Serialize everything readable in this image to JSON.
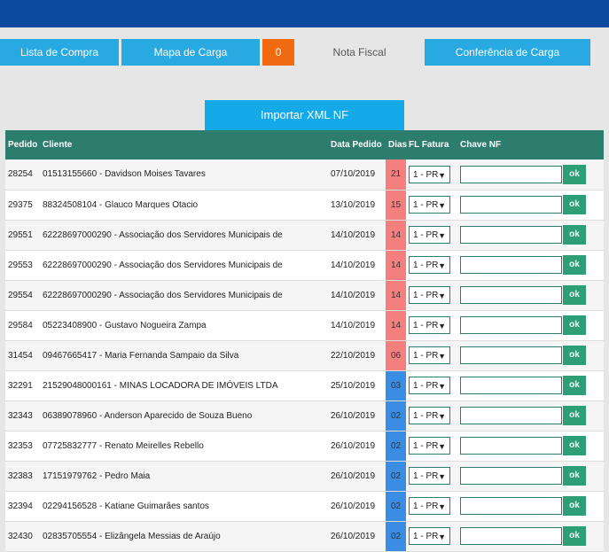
{
  "tabs": [
    {
      "label": "Lista de Compra"
    },
    {
      "label": "Mapa de Carga"
    },
    {
      "label": "0"
    },
    {
      "label": "Nota Fiscal"
    },
    {
      "label": "Conferência de Carga"
    }
  ],
  "import_button": "Importar XML NF",
  "columns": [
    "Pedido",
    "Cliente",
    "Data Pedido",
    "Dias",
    "FL Fatura",
    "Chave NF"
  ],
  "ok_label": "ok",
  "rows": [
    {
      "pedido": "28254",
      "cliente": "01513155660 - Davidson Moises Tavares",
      "data": "07/10/2019",
      "dias": "21",
      "status": "red",
      "fatura": "1 - PR"
    },
    {
      "pedido": "29375",
      "cliente": "88324508104 - Glauco Marques Otacio",
      "data": "13/10/2019",
      "dias": "15",
      "status": "red",
      "fatura": "1 - PR"
    },
    {
      "pedido": "29551",
      "cliente": "62228697000290 - Associação dos Servidores Municipais de",
      "data": "14/10/2019",
      "dias": "14",
      "status": "red",
      "fatura": "1 - PR"
    },
    {
      "pedido": "29553",
      "cliente": "62228697000290 - Associação dos Servidores Municipais de",
      "data": "14/10/2019",
      "dias": "14",
      "status": "red",
      "fatura": "1 - PR"
    },
    {
      "pedido": "29554",
      "cliente": "62228697000290 - Associação dos Servidores Municipais de",
      "data": "14/10/2019",
      "dias": "14",
      "status": "red",
      "fatura": "1 - PR"
    },
    {
      "pedido": "29584",
      "cliente": "05223408900 - Gustavo Nogueira Zampa",
      "data": "14/10/2019",
      "dias": "14",
      "status": "red",
      "fatura": "1 - PR"
    },
    {
      "pedido": "31454",
      "cliente": "09467665417 - Maria Fernanda Sampaio da Silva",
      "data": "22/10/2019",
      "dias": "06",
      "status": "red",
      "fatura": "1 - PR"
    },
    {
      "pedido": "32291",
      "cliente": "21529048000161 - MINAS LOCADORA DE IMÓVEIS LTDA",
      "data": "25/10/2019",
      "dias": "03",
      "status": "blue",
      "fatura": "1 - PR"
    },
    {
      "pedido": "32343",
      "cliente": "06389078960 - Anderson Aparecido de Souza Bueno",
      "data": "26/10/2019",
      "dias": "02",
      "status": "blue",
      "fatura": "1 - PR"
    },
    {
      "pedido": "32353",
      "cliente": "07725832777 - Renato Meirelles Rebello",
      "data": "26/10/2019",
      "dias": "02",
      "status": "blue",
      "fatura": "1 - PR"
    },
    {
      "pedido": "32383",
      "cliente": "17151979762 - Pedro Maia",
      "data": "26/10/2019",
      "dias": "02",
      "status": "blue",
      "fatura": "1 - PR"
    },
    {
      "pedido": "32394",
      "cliente": "02294156528 - Katiane Guimarães santos",
      "data": "26/10/2019",
      "dias": "02",
      "status": "blue",
      "fatura": "1 - PR"
    },
    {
      "pedido": "32430",
      "cliente": "02835705554 - Elizângela Messias de Araújo",
      "data": "26/10/2019",
      "dias": "02",
      "status": "blue",
      "fatura": "1 - PR"
    }
  ]
}
